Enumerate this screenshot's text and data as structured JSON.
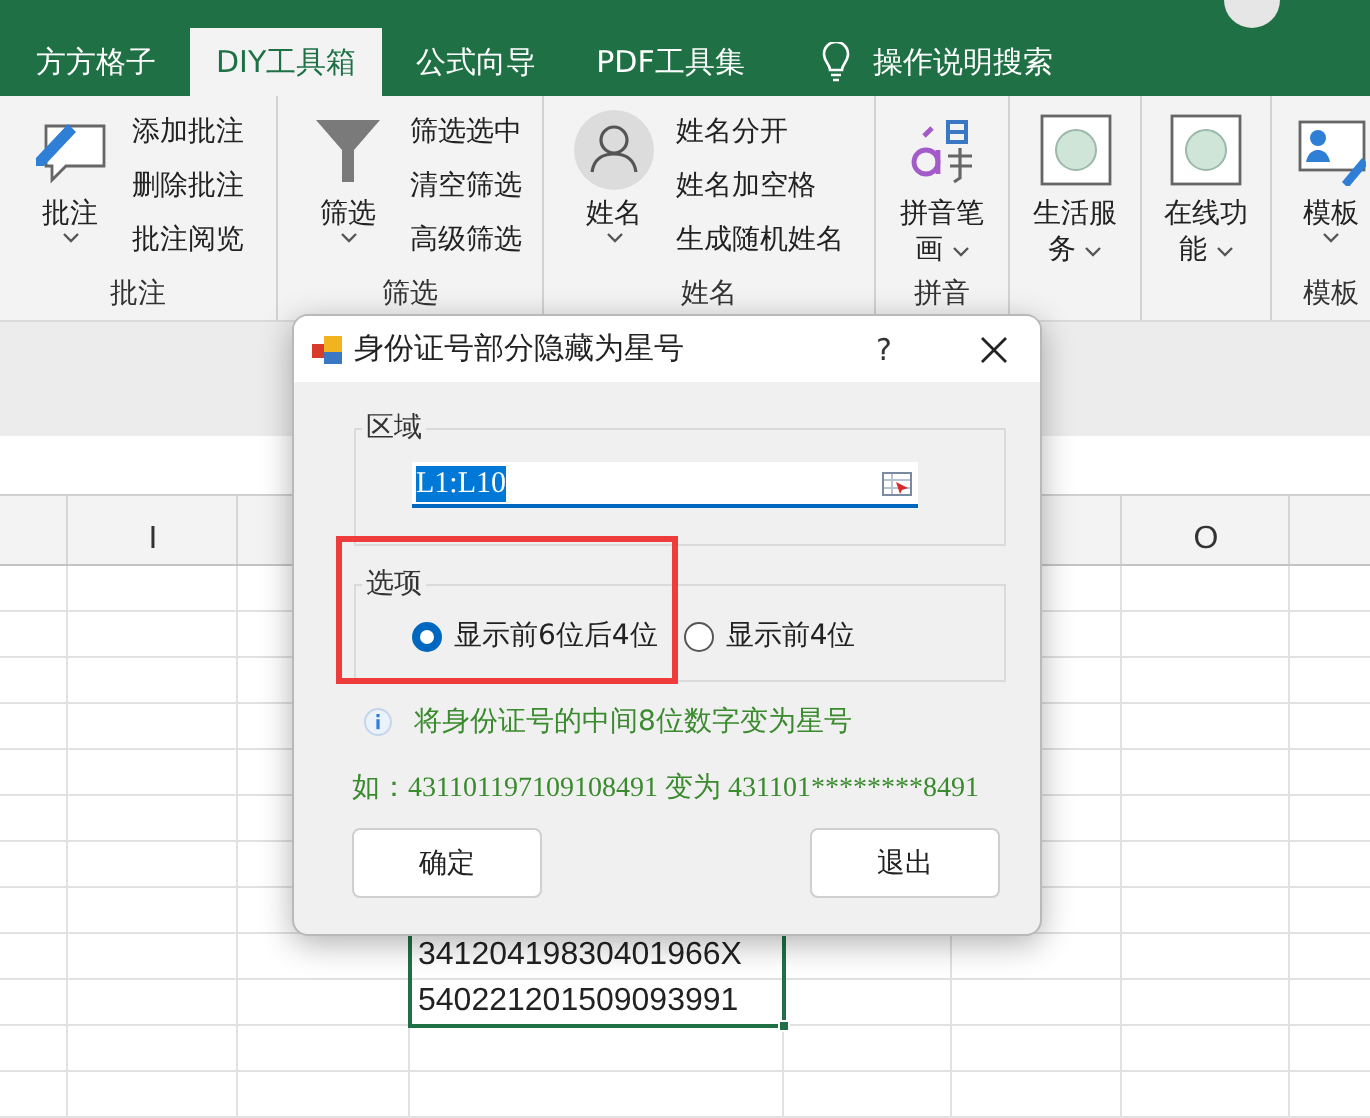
{
  "ribbon_tabs": [
    {
      "label": "方方格子",
      "selected": false
    },
    {
      "label": "DIY工具箱",
      "selected": true
    },
    {
      "label": "公式向导",
      "selected": false
    },
    {
      "label": "PDF工具集",
      "selected": false
    }
  ],
  "tell_me": {
    "label": "操作说明搜索"
  },
  "ribbon_groups": [
    {
      "kind": "comment",
      "label": "批注",
      "button_lines": [
        "批注"
      ],
      "small_buttons": [
        "添加批注",
        "删除批注",
        "批注阅览"
      ]
    },
    {
      "kind": "filter",
      "label": "筛选",
      "button_lines": [
        "筛选"
      ],
      "small_buttons": [
        "筛选选中",
        "清空筛选",
        "高级筛选"
      ]
    },
    {
      "kind": "person",
      "label": "姓名",
      "button_lines": [
        "姓名"
      ],
      "small_buttons": [
        "姓名分开",
        "姓名加空格",
        "生成随机姓名"
      ]
    },
    {
      "kind": "pinyin",
      "label": "拼音",
      "button_lines": [
        "拼音笔",
        "画"
      ]
    },
    {
      "kind": "app",
      "button_lines": [
        "生活服",
        "务"
      ]
    },
    {
      "kind": "app",
      "button_lines": [
        "在线功",
        "能"
      ]
    },
    {
      "kind": "template",
      "label": "模板",
      "button_lines": [
        "模板"
      ]
    }
  ],
  "sheet": {
    "column_headers": [
      "I",
      "O"
    ],
    "cells": [
      "34120419830401966X",
      "540221201509093991"
    ]
  },
  "dialog": {
    "title": "身份证号部分隐藏为星号",
    "help": "?",
    "range_group": {
      "legend": "区域",
      "value": "L1:L10",
      "text_selected": true
    },
    "options_group": {
      "legend": "选项",
      "options": [
        {
          "label": "显示前6位后4位",
          "selected": true
        },
        {
          "label": "显示前4位",
          "selected": false
        }
      ]
    },
    "note": "将身份证号的中间8位数字变为星号",
    "example": "如：431101197109108491 变为 431101********8491",
    "buttons": [
      "确定",
      "退出"
    ]
  }
}
